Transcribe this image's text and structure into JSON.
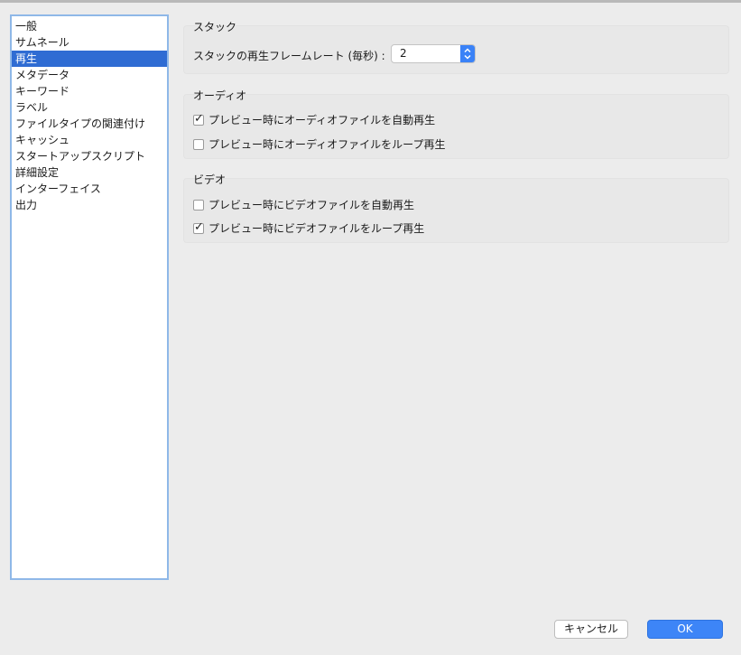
{
  "sidebar": {
    "items": [
      {
        "label": "一般",
        "selected": false
      },
      {
        "label": "サムネール",
        "selected": false
      },
      {
        "label": "再生",
        "selected": true
      },
      {
        "label": "メタデータ",
        "selected": false
      },
      {
        "label": "キーワード",
        "selected": false
      },
      {
        "label": "ラベル",
        "selected": false
      },
      {
        "label": "ファイルタイプの関連付け",
        "selected": false
      },
      {
        "label": "キャッシュ",
        "selected": false
      },
      {
        "label": "スタートアップスクリプト",
        "selected": false
      },
      {
        "label": "詳細設定",
        "selected": false
      },
      {
        "label": "インターフェイス",
        "selected": false
      },
      {
        "label": "出力",
        "selected": false
      }
    ]
  },
  "stack": {
    "title": "スタック",
    "framerate_label": "スタックの再生フレームレート (毎秒) :",
    "framerate_value": "2"
  },
  "audio": {
    "title": "オーディオ",
    "autoplay_label": "プレビュー時にオーディオファイルを自動再生",
    "autoplay_checked": true,
    "loop_label": "プレビュー時にオーディオファイルをループ再生",
    "loop_checked": false
  },
  "video": {
    "title": "ビデオ",
    "autoplay_label": "プレビュー時にビデオファイルを自動再生",
    "autoplay_checked": false,
    "loop_label": "プレビュー時にビデオファイルをループ再生",
    "loop_checked": true
  },
  "buttons": {
    "cancel_label": "キャンセル",
    "ok_label": "OK"
  },
  "colors": {
    "accent": "#3d85f7",
    "selection": "#2f6cd3",
    "focus_ring": "#8fb8e8"
  }
}
